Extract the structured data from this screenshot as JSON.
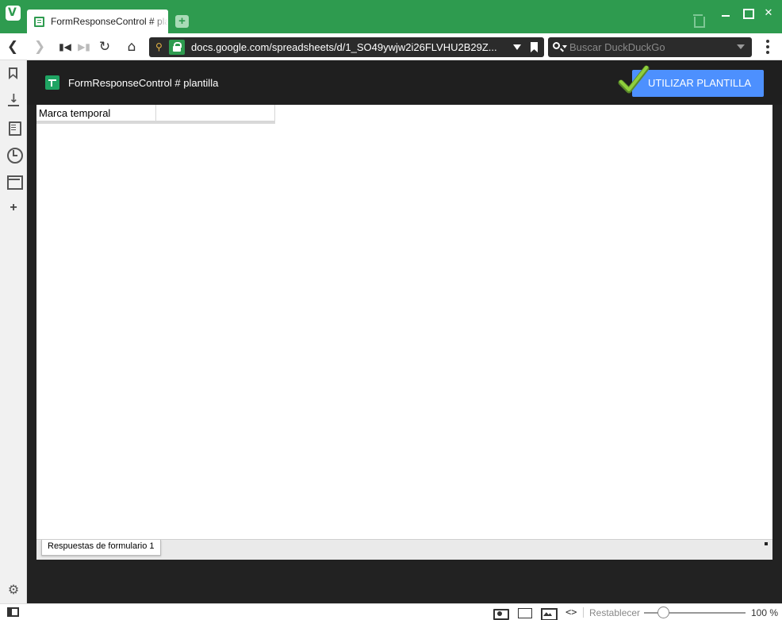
{
  "browser": {
    "tab_title": "FormResponseControl # plantilla",
    "url": "docs.google.com/spreadsheets/d/1_SO49ywjw2i26FLVHU2B29Z...",
    "search_placeholder": "Buscar DuckDuckGo",
    "logo_letter": "V"
  },
  "document": {
    "title": "FormResponseControl # plantilla",
    "template_button": "UTILIZAR PLANTILLA"
  },
  "sheet": {
    "cells": [
      "Marca temporal",
      ""
    ],
    "tabs": [
      "Respuestas de formulario 1"
    ]
  },
  "statusbar": {
    "reset_label": "Restablecer",
    "zoom_value": "100 %",
    "zoom_percent": 100
  },
  "colors": {
    "titlebar": "#2e9b4f",
    "accent_blue": "#4d90fe",
    "sheets_green": "#1fa463",
    "content_bg": "#222222"
  },
  "icons": [
    "vivaldi-logo",
    "sheets-icon",
    "new-tab-icon",
    "trash-icon",
    "minimize-icon",
    "maximize-icon",
    "close-icon",
    "back-icon",
    "forward-icon",
    "rewind-icon",
    "fast-forward-icon",
    "reload-icon",
    "home-icon",
    "key-icon",
    "lock-icon",
    "bookmark-icon",
    "search-icon",
    "menu-icon",
    "download-icon",
    "notes-icon",
    "history-icon",
    "window-icon",
    "add-panel-icon",
    "settings-icon",
    "checkmark-icon",
    "panel-toggle-icon",
    "camera-icon",
    "tile-icon",
    "image-icon",
    "code-icon"
  ]
}
